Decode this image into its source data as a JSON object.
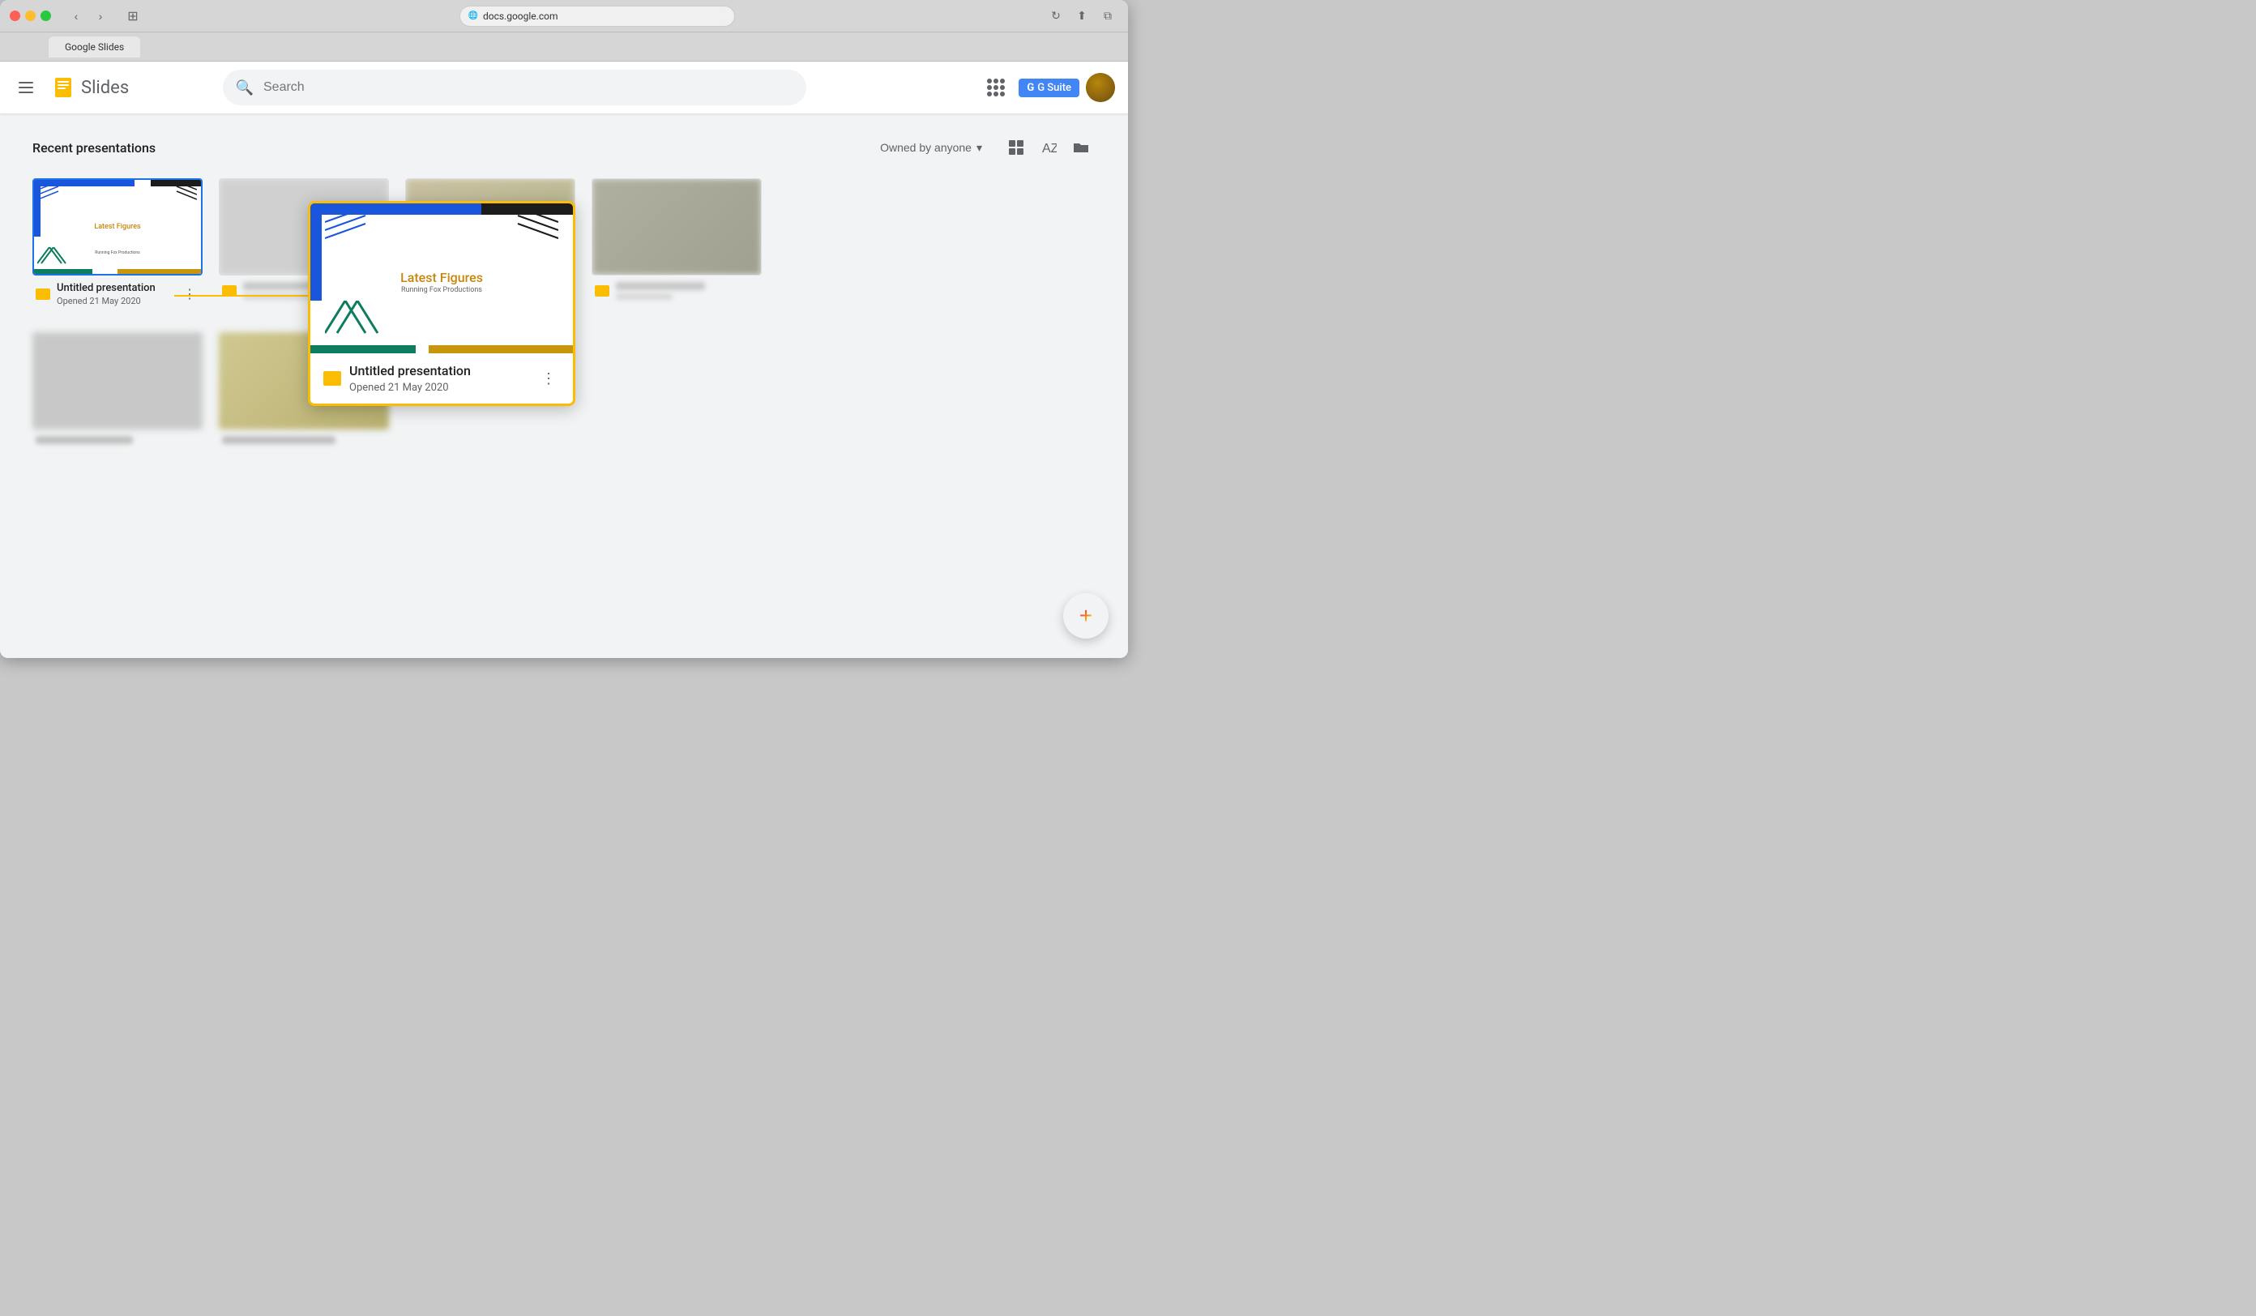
{
  "browser": {
    "url": "docs.google.com",
    "tab_label": "Google Slides"
  },
  "header": {
    "menu_label": "☰",
    "app_name": "Slides",
    "search_placeholder": "Search",
    "gsuite_label": "G Suite",
    "apps_icon": "apps"
  },
  "section": {
    "title": "Recent presentations",
    "filter_label": "Owned by anyone",
    "filter_arrow": "▾"
  },
  "cards": [
    {
      "id": "card-1",
      "name": "Untitled presentation",
      "date": "Opened 21 May 2020",
      "active": true
    },
    {
      "id": "card-2",
      "name": "",
      "date": "",
      "active": false,
      "blurred": true
    },
    {
      "id": "card-3",
      "name": "",
      "date": "",
      "active": false,
      "blurred": true
    },
    {
      "id": "card-4",
      "name": "",
      "date": "",
      "active": false,
      "blurred": true
    }
  ],
  "tooltip": {
    "title": "Untitled presentation",
    "date": "Opened 21 May 2020",
    "thumb_title": "Latest Figures",
    "thumb_subtitle": "Running Fox Productions"
  },
  "fab": {
    "label": "+"
  }
}
